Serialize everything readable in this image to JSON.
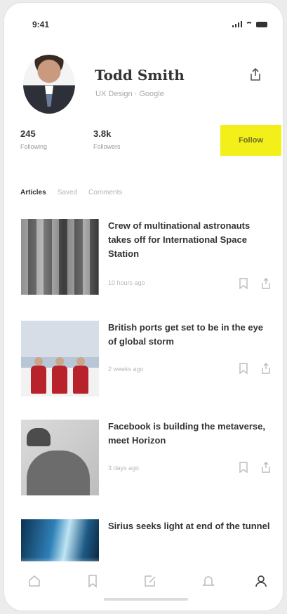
{
  "status_bar": {
    "time": "9:41"
  },
  "profile": {
    "name": "Todd Smith",
    "subtitle": "UX Design · Google",
    "stats": [
      {
        "value": "245",
        "label": "Following"
      },
      {
        "value": "3.8k",
        "label": "Followers"
      }
    ],
    "follow_label": "Follow"
  },
  "tabs": [
    {
      "label": "Articles",
      "active": true
    },
    {
      "label": "Saved",
      "active": false
    },
    {
      "label": "Comments",
      "active": false
    }
  ],
  "articles": [
    {
      "title": "Crew of multinational astronauts takes off for International Space Station",
      "time": "10 hours ago"
    },
    {
      "title": "British ports get set to be in the eye of global storm",
      "time": "2 weeks ago"
    },
    {
      "title": "Facebook is building the metaverse, meet Horizon",
      "time": "3 days ago"
    },
    {
      "title": "Sirius seeks light at end of the tunnel",
      "time": ""
    }
  ],
  "bottom_nav": [
    {
      "icon": "home-icon"
    },
    {
      "icon": "bookmark-icon"
    },
    {
      "icon": "edit-icon"
    },
    {
      "icon": "bell-icon"
    },
    {
      "icon": "profile-icon",
      "active": true
    }
  ],
  "colors": {
    "accent": "#f3ef18",
    "text": "#333333",
    "muted": "#b5b5b5"
  }
}
